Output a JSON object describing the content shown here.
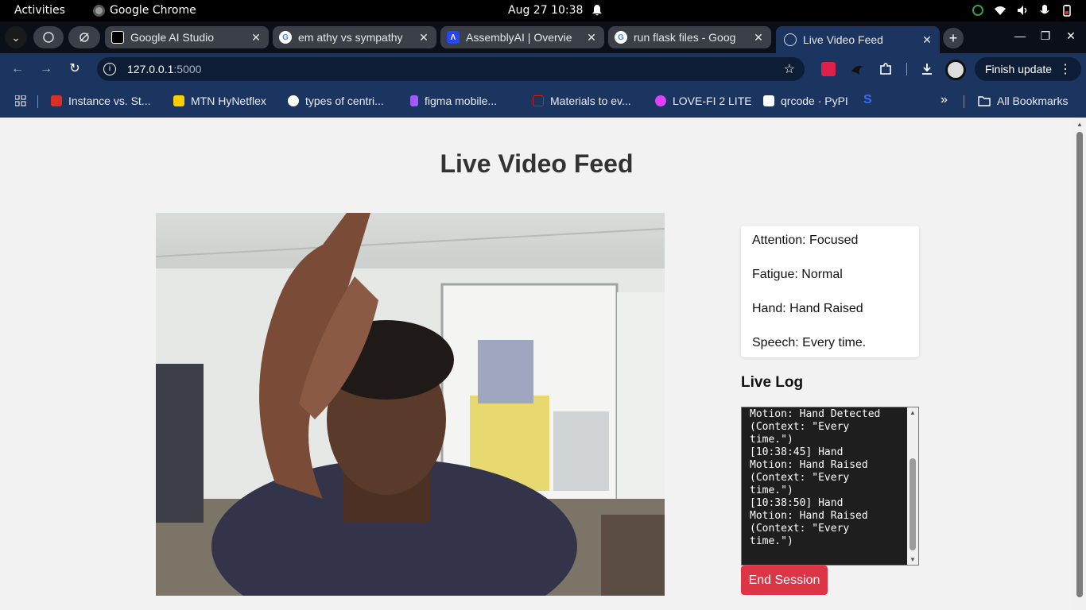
{
  "topbar": {
    "activities": "Activities",
    "app_name": "Google Chrome",
    "clock": "Aug 27  10:38"
  },
  "tabs": [
    {
      "label": "Google AI Studio",
      "icon": "ai-studio-icon"
    },
    {
      "label": "em athy vs sympathy",
      "icon": "google-icon"
    },
    {
      "label": "AssemblyAI | Overvie",
      "icon": "assemblyai-icon"
    },
    {
      "label": "run flask files - Goog",
      "icon": "google-icon"
    },
    {
      "label": "Live Video Feed",
      "icon": "globe-icon",
      "active": true
    }
  ],
  "toolbar": {
    "url_host": "127.0.0.1",
    "url_port": ":5000",
    "finish_update": "Finish update"
  },
  "bookmarks": [
    {
      "label": "Instance vs. St...",
      "color": "#d93025"
    },
    {
      "label": "MTN HyNetflex",
      "color": "#ffcc00"
    },
    {
      "label": "types of centri...",
      "color": "#4285f4"
    },
    {
      "label": "figma mobile...",
      "color": "#a259ff"
    },
    {
      "label": "Materials to ev...",
      "color": "#c5221f"
    },
    {
      "label": "LOVE-FI 2 LITE",
      "color": "#e040fb"
    },
    {
      "label": "qrcode · PyPI",
      "color": "#ffffff"
    }
  ],
  "all_bookmarks": "All Bookmarks",
  "page": {
    "title": "Live Video Feed",
    "status": {
      "attention": "Attention: Focused",
      "fatigue": "Fatigue: Normal",
      "hand": "Hand: Hand Raised",
      "speech": "Speech: Every time."
    },
    "live_log_heading": "Live Log",
    "log_text": "Motion: Hand Detected\n(Context: \"Every\ntime.\")\n[10:38:45] Hand\nMotion: Hand Raised\n(Context: \"Every\ntime.\")\n[10:38:50] Hand\nMotion: Hand Raised\n(Context: \"Every\ntime.\")",
    "end_session": "End Session"
  },
  "colors": {
    "chrome_toolbar": "#1c3560",
    "end_session": "#dc3545"
  }
}
